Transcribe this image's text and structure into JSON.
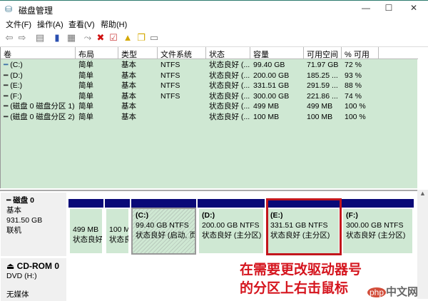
{
  "window": {
    "title": "磁盘管理",
    "min": "—",
    "max": "☐",
    "close": "✕"
  },
  "menu": [
    "文件(F)",
    "操作(A)",
    "查看(V)",
    "帮助(H)"
  ],
  "columns": [
    "卷",
    "布局",
    "类型",
    "文件系统",
    "状态",
    "容量",
    "可用空间",
    "% 可用"
  ],
  "rows": [
    {
      "vol": "(C:)",
      "layout": "简单",
      "type": "基本",
      "fs": "NTFS",
      "status": "状态良好 (...",
      "cap": "99.40 GB",
      "free": "71.97 GB",
      "pct": "72 %"
    },
    {
      "vol": "(D:)",
      "layout": "简单",
      "type": "基本",
      "fs": "NTFS",
      "status": "状态良好 (...",
      "cap": "200.00 GB",
      "free": "185.25 ...",
      "pct": "93 %"
    },
    {
      "vol": "(E:)",
      "layout": "简单",
      "type": "基本",
      "fs": "NTFS",
      "status": "状态良好 (...",
      "cap": "331.51 GB",
      "free": "291.59 ...",
      "pct": "88 %"
    },
    {
      "vol": "(F:)",
      "layout": "简单",
      "type": "基本",
      "fs": "NTFS",
      "status": "状态良好 (...",
      "cap": "300.00 GB",
      "free": "221.86 ...",
      "pct": "74 %"
    },
    {
      "vol": "(磁盘 0 磁盘分区 1)",
      "layout": "简单",
      "type": "基本",
      "fs": "",
      "status": "状态良好 (...",
      "cap": "499 MB",
      "free": "499 MB",
      "pct": "100 %"
    },
    {
      "vol": "(磁盘 0 磁盘分区 2)",
      "layout": "简单",
      "type": "基本",
      "fs": "",
      "status": "状态良好 (...",
      "cap": "100 MB",
      "free": "100 MB",
      "pct": "100 %"
    }
  ],
  "disk0": {
    "name": "磁盘 0",
    "type": "基本",
    "size": "931.50 GB",
    "state": "联机"
  },
  "partitions": [
    {
      "label": "",
      "size": "499 MB",
      "status": "状态良好"
    },
    {
      "label": "",
      "size": "100 M",
      "status": "状态良"
    },
    {
      "label": "(C:)",
      "size": "99.40 GB NTFS",
      "status": "状态良好 (启动, 页"
    },
    {
      "label": "(D:)",
      "size": "200.00 GB NTFS",
      "status": "状态良好 (主分区)"
    },
    {
      "label": "(E:)",
      "size": "331.51 GB NTFS",
      "status": "状态良好 (主分区)"
    },
    {
      "label": "(F:)",
      "size": "300.00 GB NTFS",
      "status": "状态良好 (主分区)"
    }
  ],
  "cdrom": {
    "name": "CD-ROM 0",
    "drive": "DVD (H:)",
    "state": "无媒体"
  },
  "annotation": {
    "line1": "在需要更改驱动器号",
    "line2": "的分区上右击鼠标"
  },
  "watermark": {
    "php": "php",
    "text": "中文网"
  }
}
